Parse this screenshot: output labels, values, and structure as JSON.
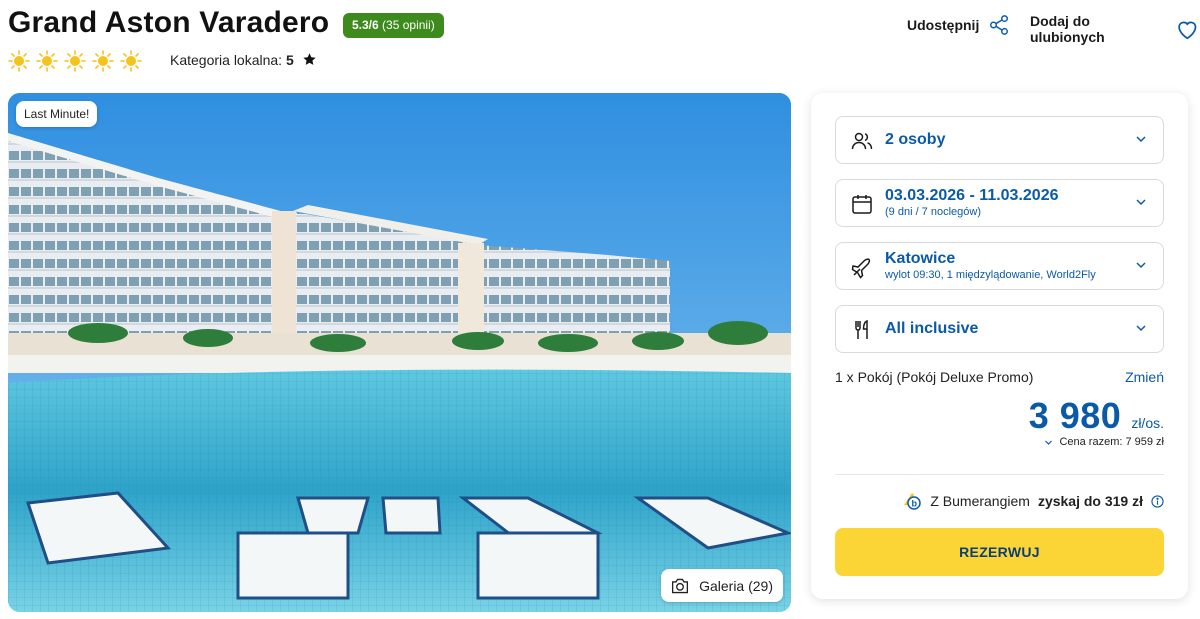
{
  "hotel": {
    "name": "Grand Aston Varadero",
    "rating_score": "5.3/6",
    "rating_count": "(35 opinii)",
    "sun_count": 5,
    "local_category_label": "Kategoria lokalna:",
    "local_category_value": "5"
  },
  "actions": {
    "share_label": "Udostępnij",
    "favorite_label": "Dodaj do ulubionych"
  },
  "photo": {
    "badge": "Last Minute!",
    "gallery_label": "Galeria (29)"
  },
  "booking": {
    "guests": {
      "value": "2 osoby"
    },
    "dates": {
      "value": "03.03.2026 - 11.03.2026",
      "detail": "(9 dni / 7 noclegów)"
    },
    "departure": {
      "value": "Katowice",
      "detail": "wylot 09:30, 1 międzylądowanie, World2Fly"
    },
    "board": {
      "value": "All inclusive"
    },
    "room_summary": "1 x Pokój  (Pokój Deluxe Promo)",
    "change_label": "Zmień",
    "price_amount": "3 980",
    "price_unit": "zł/os.",
    "total_label": "Cena razem: 7 959 zł",
    "bumerang_prefix": "Z Bumerangiem",
    "bumerang_bold": "zyskaj do 319 zł",
    "reserve_label": "REZERWUJ"
  },
  "colors": {
    "accent_blue": "#0b5aa8",
    "rating_green": "#3d8b1d",
    "reserve_yellow": "#fbd536",
    "sun_yellow": "#f6c21c"
  },
  "icons": [
    "sun-icon",
    "star-icon",
    "share-icon",
    "heart-icon",
    "people-icon",
    "calendar-icon",
    "plane-icon",
    "cutlery-icon",
    "chevron-down-icon",
    "camera-icon",
    "bumerang-logo-icon",
    "info-icon"
  ]
}
